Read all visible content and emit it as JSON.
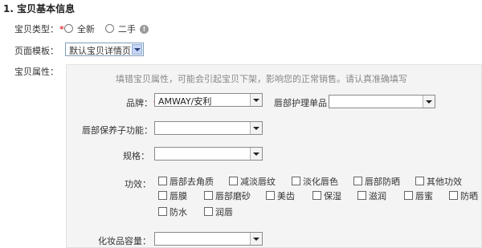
{
  "section": {
    "title": "1. 宝贝基本信息"
  },
  "item_type": {
    "label": "宝贝类型：",
    "required_mark": "*",
    "options": [
      {
        "label": "全新",
        "selected": false
      },
      {
        "label": "二手",
        "selected": false
      }
    ],
    "info_icon": "info-icon"
  },
  "page_template": {
    "label": "页面模板：",
    "value": "默认宝贝详情页"
  },
  "attributes": {
    "label": "宝贝属性：",
    "hint": "填错宝贝属性，可能会引起宝贝下架，影响您的正常销售。请认真准确填写",
    "brand": {
      "label": "品牌：",
      "required_mark": "*",
      "value": "AMWAY/安利"
    },
    "lip_care": {
      "label": "唇部护理单品",
      "value": ""
    },
    "lip_function": {
      "label": "唇部保养子功能：",
      "value": ""
    },
    "spec": {
      "label": "规格：",
      "value": ""
    },
    "efficacy": {
      "label": "功效：",
      "options": [
        {
          "label": "唇部去角质",
          "checked": false
        },
        {
          "label": "减淡唇纹",
          "checked": false
        },
        {
          "label": "淡化唇色",
          "checked": false
        },
        {
          "label": "唇部防晒",
          "checked": false
        },
        {
          "label": "其他功效",
          "checked": false
        },
        {
          "label": "唇膜",
          "checked": false
        },
        {
          "label": "唇部磨砂",
          "checked": false
        },
        {
          "label": "美齿",
          "checked": false
        },
        {
          "label": "保湿",
          "checked": false
        },
        {
          "label": "滋润",
          "checked": false
        },
        {
          "label": "唇蜜",
          "checked": false
        },
        {
          "label": "防晒",
          "checked": false
        },
        {
          "label": "防水",
          "checked": false
        },
        {
          "label": "润唇",
          "checked": false
        }
      ]
    },
    "capacity": {
      "label": "化妆品容量：",
      "value": ""
    }
  }
}
